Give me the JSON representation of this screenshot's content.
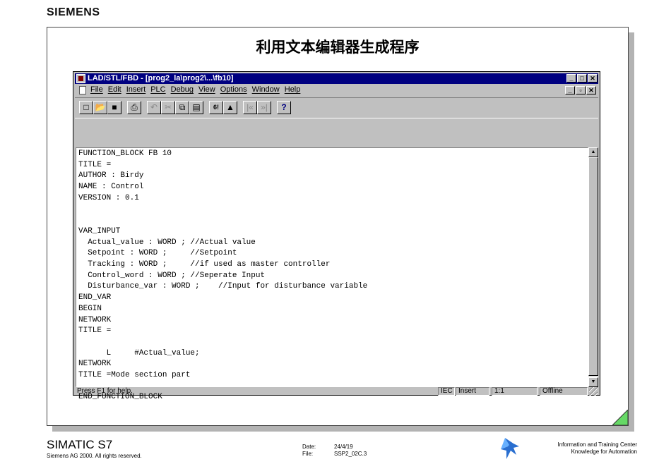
{
  "header": {
    "brand": "SIEMENS"
  },
  "slide": {
    "title": "利用文本编辑器生成程序"
  },
  "window": {
    "title": "LAD/STL/FBD  - [prog2_la\\prog2\\...\\fb10]",
    "menu": [
      "File",
      "Edit",
      "Insert",
      "PLC",
      "Debug",
      "View",
      "Options",
      "Window",
      "Help"
    ],
    "toolbar_icons": [
      "new-icon",
      "open-icon",
      "save-icon",
      "print-icon",
      "undo-icon",
      "cut-icon",
      "copy-icon",
      "paste-icon",
      "compile-icon",
      "download-icon",
      "prev-icon",
      "next-icon",
      "help-icon"
    ],
    "code": "FUNCTION_BLOCK FB 10\nTITLE =\nAUTHOR : Birdy\nNAME : Control\nVERSION : 0.1\n\n\nVAR_INPUT\n  Actual_value : WORD ; //Actual value\n  Setpoint : WORD ;     //Setpoint\n  Tracking : WORD ;     //if used as master controller\n  Control_word : WORD ; //Seperate Input\n  Disturbance_var : WORD ;    //Input for disturbance variable\nEND_VAR\nBEGIN\nNETWORK\nTITLE =\n\n      L     #Actual_value;\nNETWORK\nTITLE =Mode section part\n\nEND_FUNCTION_BLOCK",
    "status": {
      "help": "Press F1 for help.",
      "lang": "IEC",
      "mode": "Insert",
      "position": "1:1",
      "state": "Offline"
    }
  },
  "footer": {
    "product": "SIMATIC S7",
    "copyright": "Siemens AG 2000. All rights reserved.",
    "date_label": "Date:",
    "date": "24/4/19",
    "file_label": "File:",
    "file": "SSP2_02C.3",
    "info_line1": "Information and Training Center",
    "info_line2": "Knowledge for Automation"
  }
}
